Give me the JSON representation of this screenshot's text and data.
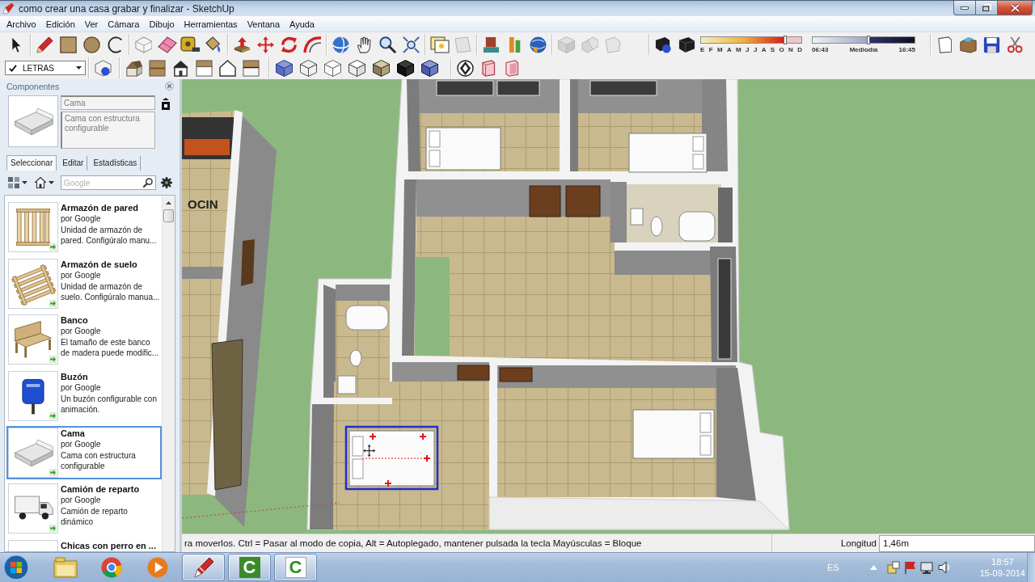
{
  "window": {
    "title": "como crear una casa grabar y finalizar - SketchUp"
  },
  "menu": [
    "Archivo",
    "Edición",
    "Ver",
    "Cámara",
    "Dibujo",
    "Herramientas",
    "Ventana",
    "Ayuda"
  ],
  "toolbar": {
    "layer_dropdown": {
      "value": "LETRAS",
      "checked": true
    },
    "date_slider": {
      "labels": [
        "E",
        "F",
        "M",
        "A",
        "M",
        "J",
        "J",
        "A",
        "S",
        "O",
        "N",
        "D"
      ],
      "level": 0.84
    },
    "time_slider": {
      "labels": [
        "06:43",
        "Mediodía",
        "16:45"
      ],
      "level": 0.55
    }
  },
  "components_panel": {
    "title": "Componentes",
    "preview": {
      "kind": "bed",
      "name": "Cama",
      "description": "Cama con estructura configurable"
    },
    "tabs": [
      {
        "label": "Seleccionar",
        "selected": true
      },
      {
        "label": "Editar",
        "selected": false
      },
      {
        "label": "Estadísticas",
        "selected": false
      }
    ],
    "search": {
      "placeholder": "Google"
    },
    "items": [
      {
        "kind": "frame",
        "title": "Armazón de pared",
        "author": "por Google",
        "description": "Unidad de armazón de pared. Configúralo manu...",
        "selected": false
      },
      {
        "kind": "joists",
        "title": "Armazón de suelo",
        "author": "por Google",
        "description": "Unidad de armazón de suelo. Configúralo manua...",
        "selected": false
      },
      {
        "kind": "bench",
        "title": "Banco",
        "author": "por Google",
        "description": "El tamaño de este banco de madera puede modific...",
        "selected": false
      },
      {
        "kind": "mailbox",
        "title": "Buzón",
        "author": "por Google",
        "description": "Un buzón configurable con animación.",
        "selected": false
      },
      {
        "kind": "bed",
        "title": "Cama",
        "author": "por Google",
        "description": "Cama con estructura configurable",
        "selected": true
      },
      {
        "kind": "truck",
        "title": "Camión de reparto",
        "author": "por Google",
        "description": "Camión de reparto dinámico",
        "selected": false
      },
      {
        "kind": "blank",
        "title": "Chicas con perro en ...",
        "selected": false
      }
    ]
  },
  "viewport": {
    "model_text": "OCIN"
  },
  "status_bar": {
    "hint": "ra moverlos. Ctrl = Pasar al modo de copia, Alt = Autoplegado, mantener pulsada la tecla Mayúsculas = Bloque",
    "measure_label": "Longitud",
    "measure_value": "1,46m"
  },
  "taskbar": {
    "apps": [
      {
        "kind": "folder",
        "running": false
      },
      {
        "kind": "browser",
        "running": false
      },
      {
        "kind": "player",
        "running": false
      },
      {
        "kind": "pencil",
        "running": true
      },
      {
        "kind": "letter",
        "glyph": "C",
        "running": true
      },
      {
        "kind": "letter-light",
        "glyph": "C",
        "running": true
      }
    ],
    "language": "ES",
    "time": "18:57",
    "date": "15-09-2014"
  }
}
